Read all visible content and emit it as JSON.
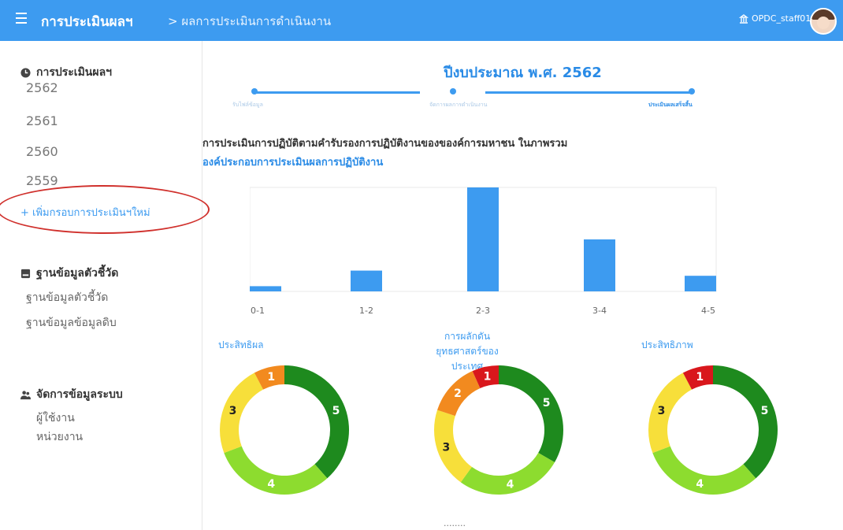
{
  "header": {
    "title": "การประเมินผลฯ",
    "breadcrumb": "> ผลการประเมินการดำเนินงาน",
    "user": "OPDC_staff01"
  },
  "sidebar": {
    "section1": {
      "label": "การประเมินผลฯ",
      "years": [
        "2562",
        "2561",
        "2560",
        "2559"
      ],
      "add_link": "+ เพิ่มกรอบการประเมินฯใหม่"
    },
    "section2": {
      "label": "ฐานข้อมูลตัวชี้วัด",
      "items": [
        "ฐานข้อมูลตัวชี้วัด",
        "ฐานข้อมูลข้อมูลดิบ"
      ]
    },
    "section3": {
      "label": "จัดการข้อมูลระบบ",
      "items": [
        "ผู้ใช้งาน",
        "หน่วยงาน"
      ]
    }
  },
  "main": {
    "fiscal_title": "ปีงบประมาณ พ.ศ. 2562",
    "steps": [
      "รับไฟล์ข้อมูล",
      "จัดการผลการดำเนินงาน",
      "ประเมินผลเสร็จสิ้น"
    ],
    "subtitle1": "การประเมินการปฏิบัติตามคำรับรองการปฏิบัติงานของของค์การมหาชน ในภาพรวม",
    "subtitle2": "องค์ประกอบการประเมินผลการปฏิบัติงาน",
    "bottom_text": "........"
  },
  "colors": {
    "accent": "#3d9bf0",
    "dark_green": "#1e8a1e",
    "light_green": "#8ddc2f",
    "yellow": "#f7df3a",
    "orange": "#f28a1f",
    "red": "#d9171c"
  },
  "chart_data": [
    {
      "type": "bar",
      "categories": [
        "0-1",
        "1-2",
        "2-3",
        "3-4",
        "4-5"
      ],
      "values": [
        1,
        4,
        20,
        10,
        3
      ],
      "ylim": [
        0,
        20
      ]
    },
    {
      "type": "pie",
      "title": "ประสิทธิผล",
      "slices": [
        {
          "label": "5",
          "value": 5,
          "color": "#1e8a1e"
        },
        {
          "label": "4",
          "value": 4,
          "color": "#8ddc2f"
        },
        {
          "label": "3",
          "value": 3,
          "color": "#f7df3a"
        },
        {
          "label": "1",
          "value": 1,
          "color": "#f28a1f"
        }
      ]
    },
    {
      "type": "pie",
      "title": "การผลักดันยุทธศาสตร์ของประเทศ",
      "slices": [
        {
          "label": "5",
          "value": 5,
          "color": "#1e8a1e"
        },
        {
          "label": "4",
          "value": 4,
          "color": "#8ddc2f"
        },
        {
          "label": "3",
          "value": 3,
          "color": "#f7df3a"
        },
        {
          "label": "2",
          "value": 2,
          "color": "#f28a1f"
        },
        {
          "label": "1",
          "value": 1,
          "color": "#d9171c"
        }
      ]
    },
    {
      "type": "pie",
      "title": "ประสิทธิภาพ",
      "slices": [
        {
          "label": "5",
          "value": 5,
          "color": "#1e8a1e"
        },
        {
          "label": "4",
          "value": 4,
          "color": "#8ddc2f"
        },
        {
          "label": "3",
          "value": 3,
          "color": "#f7df3a"
        },
        {
          "label": "1",
          "value": 1,
          "color": "#d9171c"
        }
      ]
    }
  ]
}
